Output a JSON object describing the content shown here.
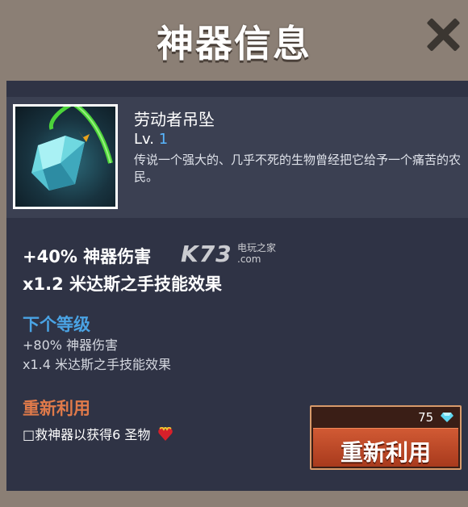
{
  "dialog": {
    "title": "神器信息"
  },
  "artifact": {
    "name": "劳动者吊坠",
    "level_prefix": "Lv.",
    "level": "1",
    "description": "传说一个强大的、几乎不死的生物曾经把它给予一个痛苦的农民。",
    "icon": "crystal-pendant-icon"
  },
  "current_effects": [
    "+40% 神器伤害",
    "x1.2 米达斯之手技能效果"
  ],
  "next_level": {
    "title": "下个等级",
    "effects": [
      "+80% 神器伤害",
      "x1.4 米达斯之手技能效果"
    ]
  },
  "recycle": {
    "title": "重新利用",
    "description": "□救神器以获得6 圣物",
    "button_label": "重新利用",
    "cost": "75",
    "cost_icon": "diamond-icon"
  },
  "watermark": {
    "logo": "K73",
    "line1": "电玩之家",
    "line2": ".com"
  },
  "colors": {
    "panel": "#2f3345",
    "next_level_title": "#4aa3e4",
    "recycle_title": "#e07a4a",
    "recycle_button": "#c24d2b",
    "level_number": "#59b6ff"
  }
}
